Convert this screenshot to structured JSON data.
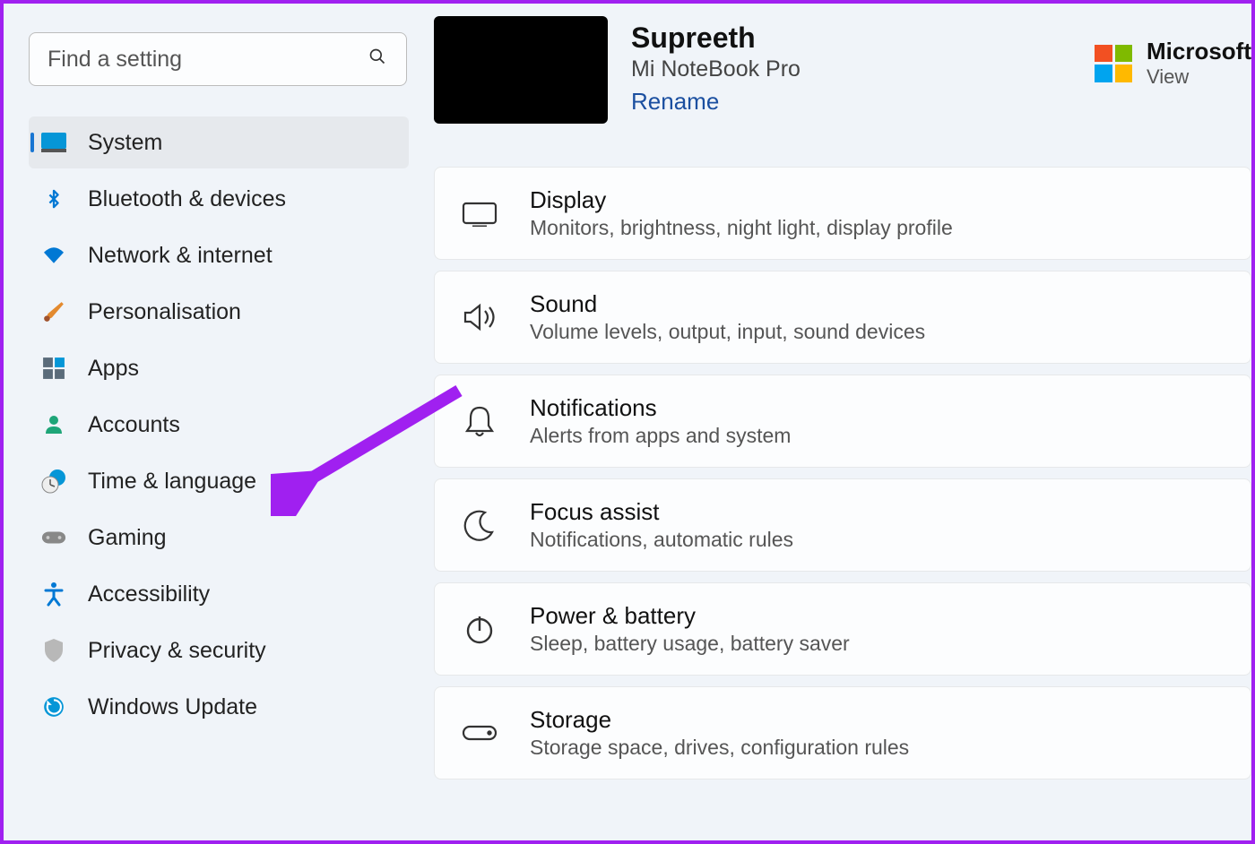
{
  "search": {
    "placeholder": "Find a setting"
  },
  "sidebar": {
    "items": [
      {
        "label": "System"
      },
      {
        "label": "Bluetooth & devices"
      },
      {
        "label": "Network & internet"
      },
      {
        "label": "Personalisation"
      },
      {
        "label": "Apps"
      },
      {
        "label": "Accounts"
      },
      {
        "label": "Time & language"
      },
      {
        "label": "Gaming"
      },
      {
        "label": "Accessibility"
      },
      {
        "label": "Privacy & security"
      },
      {
        "label": "Windows Update"
      }
    ]
  },
  "header": {
    "user_name": "Supreeth",
    "device_model": "Mi NoteBook Pro",
    "rename": "Rename",
    "ms_title": "Microsoft",
    "ms_sub": "View"
  },
  "cards": [
    {
      "title": "Display",
      "sub": "Monitors, brightness, night light, display profile"
    },
    {
      "title": "Sound",
      "sub": "Volume levels, output, input, sound devices"
    },
    {
      "title": "Notifications",
      "sub": "Alerts from apps and system"
    },
    {
      "title": "Focus assist",
      "sub": "Notifications, automatic rules"
    },
    {
      "title": "Power & battery",
      "sub": "Sleep, battery usage, battery saver"
    },
    {
      "title": "Storage",
      "sub": "Storage space, drives, configuration rules"
    }
  ]
}
